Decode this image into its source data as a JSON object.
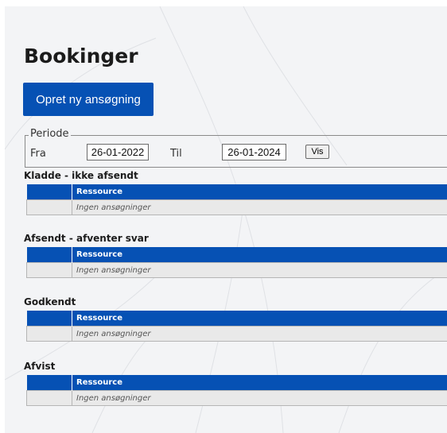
{
  "page": {
    "title": "Bookinger"
  },
  "actions": {
    "new_application": "Opret ny ansøgning"
  },
  "period": {
    "legend": "Periode",
    "from_label": "Fra",
    "from_value": "26-01-2022",
    "to_label": "Til",
    "to_value": "26-01-2024",
    "show_button": "Vis"
  },
  "sections": [
    {
      "title": "Kladde - ikke afsendt",
      "column": "Ressource",
      "empty": "Ingen ansøgninger"
    },
    {
      "title": "Afsendt - afventer svar",
      "column": "Ressource",
      "empty": "Ingen ansøgninger"
    },
    {
      "title": "Godkendt",
      "column": "Ressource",
      "empty": "Ingen ansøgninger"
    },
    {
      "title": "Afvist",
      "column": "Ressource",
      "empty": "Ingen ansøgninger"
    }
  ],
  "colors": {
    "primary": "#0651b4",
    "background": "#f3f4f6",
    "empty_row": "#e9e9e9"
  }
}
